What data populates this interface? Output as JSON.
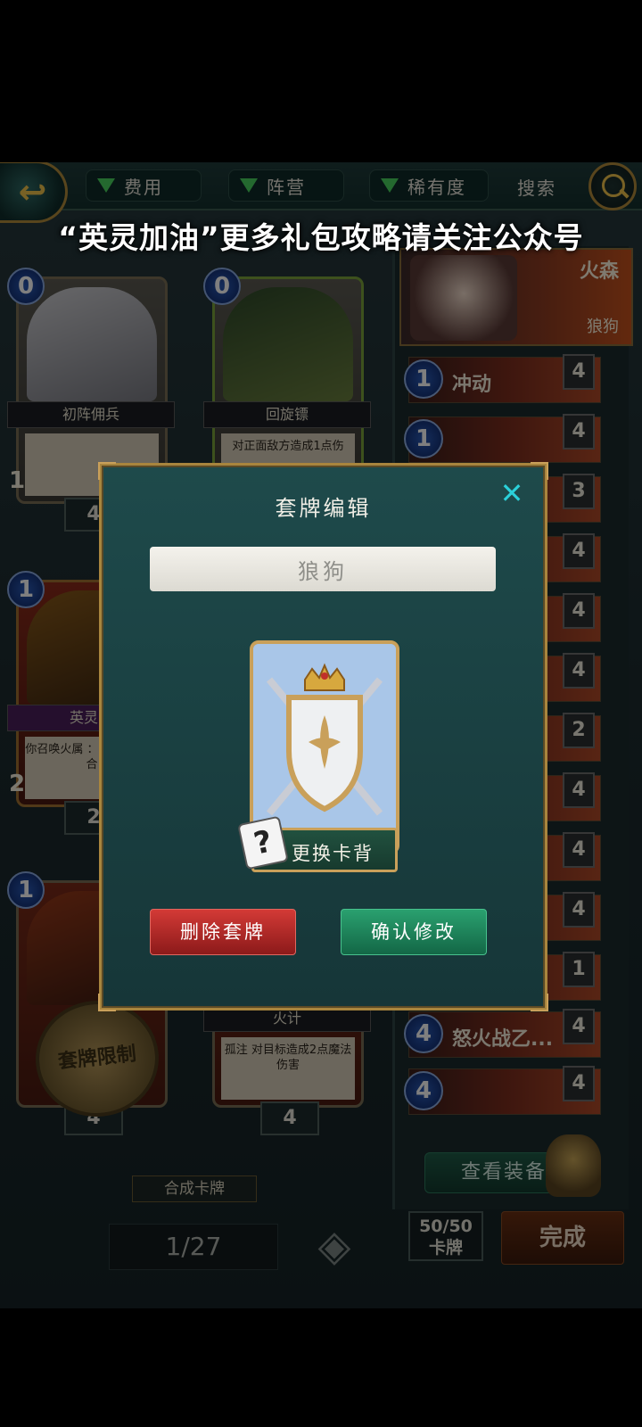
{
  "topbar": {
    "filters": [
      {
        "label": "费用"
      },
      {
        "label": "阵营"
      },
      {
        "label": "稀有度"
      }
    ],
    "search_label": "搜索"
  },
  "watermark": "“英灵加油”更多礼包攻略请关注公众号",
  "cards": [
    {
      "cost": "0",
      "name": "初阵佣兵",
      "desc": "",
      "count": "4",
      "atk": "1"
    },
    {
      "cost": "0",
      "name": "回旋镖",
      "desc": "对正面敌方造成1点伤",
      "count": "",
      "atk": ""
    },
    {
      "cost": "1",
      "name": "英灵号",
      "desc": "你召唤火属 ：该生物+ 回合",
      "count": "2",
      "atk": "2"
    },
    {
      "cost": "1",
      "name": "",
      "desc": "",
      "count": "4",
      "atk": ""
    },
    {
      "cost": "",
      "name": "火计",
      "desc": "孤注 对目标造成2点魔法伤害",
      "count": "4",
      "atk": ""
    }
  ],
  "restrict_seal": "套牌限制",
  "hero": {
    "faction": "火森",
    "deck_name": "狼狗"
  },
  "deck_list": [
    {
      "cost": "1",
      "name": "冲动",
      "count": "4"
    },
    {
      "cost": "1",
      "name": "",
      "count": "4"
    },
    {
      "cost": "",
      "name": "",
      "count": "3"
    },
    {
      "cost": "",
      "name": "",
      "count": "4"
    },
    {
      "cost": "",
      "name": "",
      "count": "4"
    },
    {
      "cost": "",
      "name": "",
      "count": "4"
    },
    {
      "cost": "",
      "name": "",
      "count": "2"
    },
    {
      "cost": "",
      "name": "",
      "count": "4"
    },
    {
      "cost": "",
      "name": "",
      "count": "4"
    },
    {
      "cost": "",
      "name": "",
      "count": "4"
    },
    {
      "cost": "",
      "name": "",
      "count": "1"
    },
    {
      "cost": "4",
      "name": "怒火战乙...",
      "count": "4"
    },
    {
      "cost": "4",
      "name": "",
      "count": "4"
    }
  ],
  "equip_button": "查看装备",
  "deck_counter": {
    "value": "50/50",
    "unit": "卡牌"
  },
  "done_button": "完成",
  "craft_label": "合成卡牌",
  "page_indicator": "1/27",
  "modal": {
    "title": "套牌编辑",
    "deck_name_value": "狼狗",
    "change_back_label": "更换卡背",
    "delete_label": "删除套牌",
    "confirm_label": "确认修改"
  },
  "colors": {
    "accent_gold": "#c9a05a",
    "close_cyan": "#2bd0d9",
    "delete_red": "#c8302e",
    "confirm_green": "#1f8a5c"
  }
}
